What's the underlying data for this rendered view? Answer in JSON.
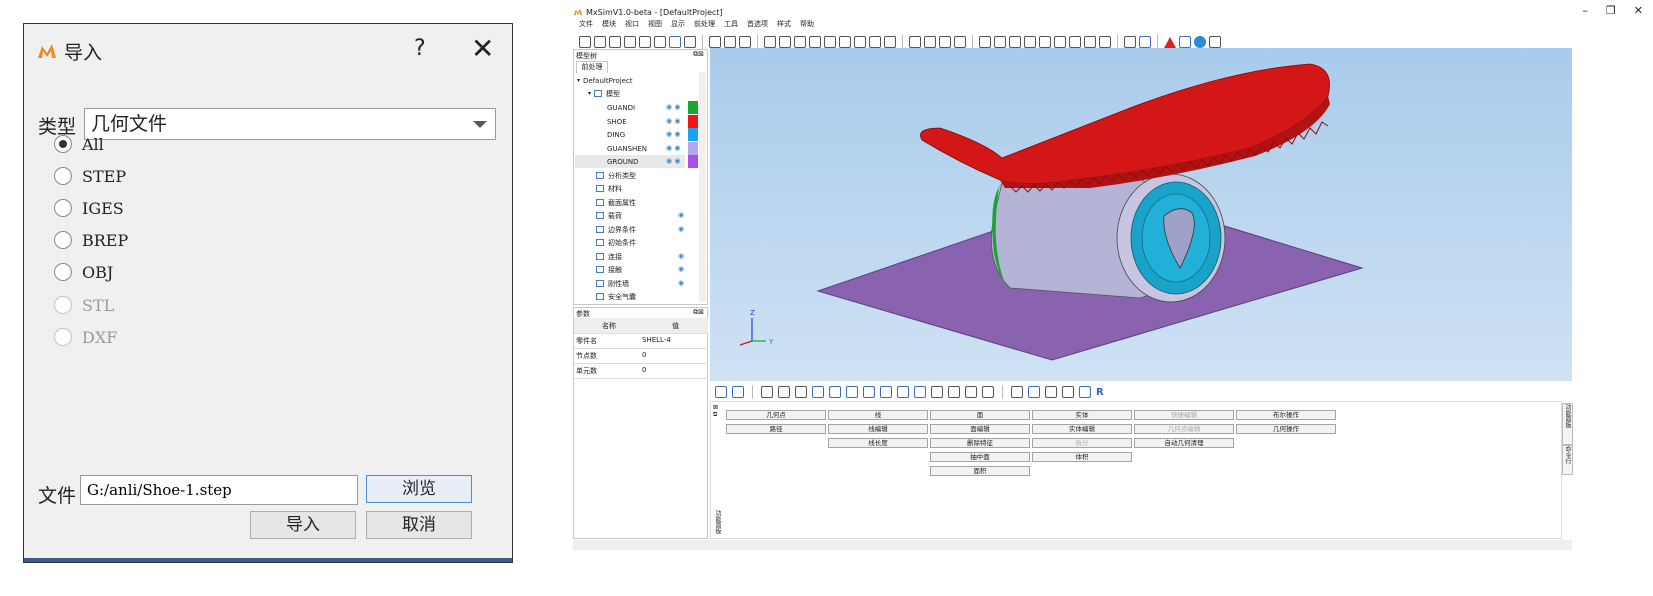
{
  "dialog": {
    "title": "导入",
    "help": "?",
    "close": "✕",
    "type_label": "类型",
    "type_value": "几何文件",
    "radio_options": [
      {
        "label": "All",
        "checked": true,
        "enabled": true
      },
      {
        "label": "STEP",
        "checked": false,
        "enabled": true
      },
      {
        "label": "IGES",
        "checked": false,
        "enabled": true
      },
      {
        "label": "BREP",
        "checked": false,
        "enabled": true
      },
      {
        "label": "OBJ",
        "checked": false,
        "enabled": true
      },
      {
        "label": "STL",
        "checked": false,
        "enabled": false
      },
      {
        "label": "DXF",
        "checked": false,
        "enabled": false
      }
    ],
    "file_label": "文件",
    "file_value": "G:/anli/Shoe-1.step",
    "browse_label": "浏览",
    "import_label": "导入",
    "cancel_label": "取消"
  },
  "app": {
    "title": "MxSimV1.0-beta - [DefaultProject]",
    "window_controls": [
      "–",
      "❐",
      "✕"
    ],
    "menu": [
      "文件",
      "模块",
      "视口",
      "视图",
      "显示",
      "前处理",
      "工具",
      "首选项",
      "样式",
      "帮助"
    ],
    "model_tree_title": "模型树",
    "tree_tab": "前处理",
    "tree": {
      "project": "DefaultProject",
      "geometry": "模型",
      "parts": [
        {
          "name": "GUANDI",
          "color": "#1aa531"
        },
        {
          "name": "SHOE",
          "color": "#ee1515"
        },
        {
          "name": "DING",
          "color": "#1aa3ee"
        },
        {
          "name": "GUANSHEN",
          "color": "#b3a8ee"
        },
        {
          "name": "GROUND",
          "color": "#b04bee"
        }
      ],
      "items": [
        "分析类型",
        "材料",
        "截面属性",
        "载荷",
        "边界条件",
        "初始条件",
        "连接",
        "接触",
        "刚性墙",
        "安全气囊"
      ]
    },
    "params_title": "参数",
    "params_headers": [
      "名称",
      "值"
    ],
    "params_rows": [
      {
        "name": "零件名",
        "value": "SHELL-4"
      },
      {
        "name": "节点数",
        "value": "0"
      },
      {
        "name": "单元数",
        "value": "0"
      }
    ],
    "axis_labels": {
      "z": "Z",
      "y": "Y"
    },
    "function_buttons": [
      [
        "几何点",
        "线",
        "面",
        "实体",
        "快捷编辑",
        "布尔操作"
      ],
      [
        "路径",
        "线编辑",
        "面编辑",
        "实体编辑",
        "几何点编辑",
        "几何操作"
      ],
      [
        "",
        "线长度",
        "删除特征",
        "拆分",
        "自动几何清理",
        ""
      ],
      [
        "",
        "",
        "抽中面",
        "体积",
        "",
        ""
      ],
      [
        "",
        "",
        "面积",
        "",
        "",
        ""
      ]
    ],
    "function_panel_label": "功能面板",
    "side_tabs": [
      "功能面板",
      "命令行"
    ],
    "fb_r": "R"
  }
}
